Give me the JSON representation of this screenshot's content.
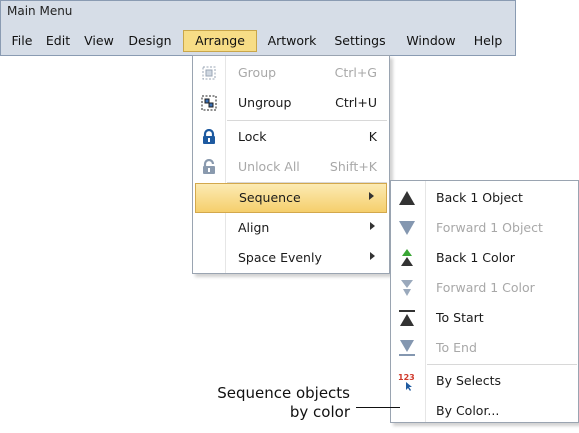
{
  "window": {
    "title": "Main Menu"
  },
  "menubar": {
    "items": [
      {
        "label": "File"
      },
      {
        "label": "Edit"
      },
      {
        "label": "View"
      },
      {
        "label": "Design"
      },
      {
        "label": "Arrange"
      },
      {
        "label": "Artwork"
      },
      {
        "label": "Settings"
      },
      {
        "label": "Window"
      },
      {
        "label": "Help"
      }
    ],
    "active": "Arrange"
  },
  "arrange_menu": {
    "items": [
      {
        "label": "Group",
        "shortcut": "Ctrl+G",
        "enabled": false,
        "icon": "group-icon"
      },
      {
        "label": "Ungroup",
        "shortcut": "Ctrl+U",
        "enabled": true,
        "icon": "ungroup-icon"
      },
      {
        "label": "Lock",
        "shortcut": "K",
        "enabled": true,
        "icon": "lock-icon"
      },
      {
        "label": "Unlock All",
        "shortcut": "Shift+K",
        "enabled": false,
        "icon": "unlock-icon"
      },
      {
        "label": "Sequence",
        "submenu": true,
        "highlighted": true
      },
      {
        "label": "Align",
        "submenu": true
      },
      {
        "label": "Space Evenly",
        "submenu": true
      }
    ]
  },
  "sequence_submenu": {
    "items": [
      {
        "label": "Back 1 Object",
        "enabled": true,
        "icon": "back-object-icon"
      },
      {
        "label": "Forward 1 Object",
        "enabled": false,
        "icon": "forward-object-icon"
      },
      {
        "label": "Back 1 Color",
        "enabled": true,
        "icon": "back-color-icon"
      },
      {
        "label": "Forward 1 Color",
        "enabled": false,
        "icon": "forward-color-icon"
      },
      {
        "label": "To Start",
        "enabled": true,
        "icon": "to-start-icon"
      },
      {
        "label": "To End",
        "enabled": false,
        "icon": "to-end-icon"
      },
      {
        "label": "By Selects",
        "enabled": true,
        "icon": "by-selects-icon",
        "icon_text": "123"
      },
      {
        "label": "By Color...",
        "enabled": true
      }
    ]
  },
  "callout": {
    "line1": "Sequence objects",
    "line2": "by color"
  },
  "colors": {
    "menubar_bg": "#d6dde7",
    "active_menu_bg": "#f7dd86",
    "highlight_bg": "#f5cf6c",
    "icon_blue": "#1e5aa0",
    "icon_green": "#3aa635",
    "disabled_text": "#a8a8a8"
  }
}
